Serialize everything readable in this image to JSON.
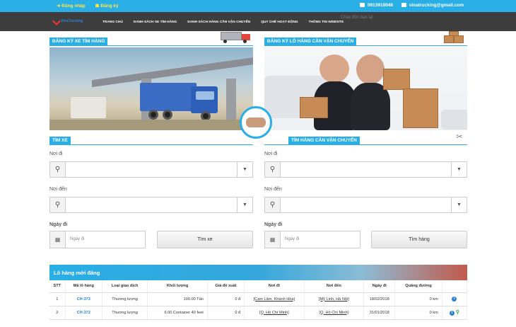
{
  "topbar": {
    "login": "Đăng nhập",
    "register": "Đăng ký",
    "phone": "0913918048",
    "email": "vinatrucking@gmail.com"
  },
  "nav": {
    "logo_text": "VinaTrucking",
    "items": [
      "TRANG CHỦ",
      "DANH SÁCH XE TÌM HÀNG",
      "DANH SÁCH HÀNG CẦN VẬN CHUYỂN",
      "QUY CHẾ HOẠT ĐỘNG",
      "THÔNG TIN WEBSITE"
    ],
    "search_ghost": "Chào đón bạn lại"
  },
  "left": {
    "header": "ĐĂNG KÝ XE TÌM HÀNG",
    "search_header": "TÌM XE",
    "from_label": "Nơi đi",
    "to_label": "Nơi đến",
    "date_label": "Ngày đi",
    "date_placeholder": "Ngày đi",
    "button": "Tìm xe"
  },
  "right": {
    "header": "ĐĂNG KÝ LÔ HÀNG CẦN VẬN CHUYỂN",
    "search_header": "TÌM HÀNG CẦN VẬN CHUYỂN",
    "from_label": "Nơi đi",
    "to_label": "Nơi đến",
    "date_label": "Ngày đi",
    "date_placeholder": "Ngày đi",
    "button": "Tìm hàng"
  },
  "table": {
    "title": "Lô hàng mới đăng",
    "headers": [
      "STT",
      "Mã lô hàng",
      "Loại giao dịch",
      "Khối lượng",
      "Giá đề xuất",
      "Nơi đi",
      "Nơi đến",
      "Ngày đi",
      "Quãng đường",
      ""
    ],
    "rows": [
      {
        "stt": "1",
        "code": "CH-373",
        "type": "Thương lượng",
        "weight": "100.00 Tấn",
        "price": "0 đ",
        "from": "[Cam Lâm, Khánh Hòa]",
        "to": "[Mỹ Linh, Hà Nội]",
        "date": "18/02/2018",
        "distance": "0 km"
      },
      {
        "stt": "2",
        "code": "CH-372",
        "type": "Thương lượng",
        "weight": "6.00 Container 40 feet",
        "price": "0 đ",
        "from": "[Q. Hồ Chí Minh]",
        "to": "[Q. Hồ Chí Minh]",
        "date": "31/01/2018",
        "distance": "0 km"
      }
    ]
  },
  "colors": {
    "accent": "#29aee6",
    "nav_bg": "#3d3d3d",
    "link": "#2a7fd6"
  }
}
